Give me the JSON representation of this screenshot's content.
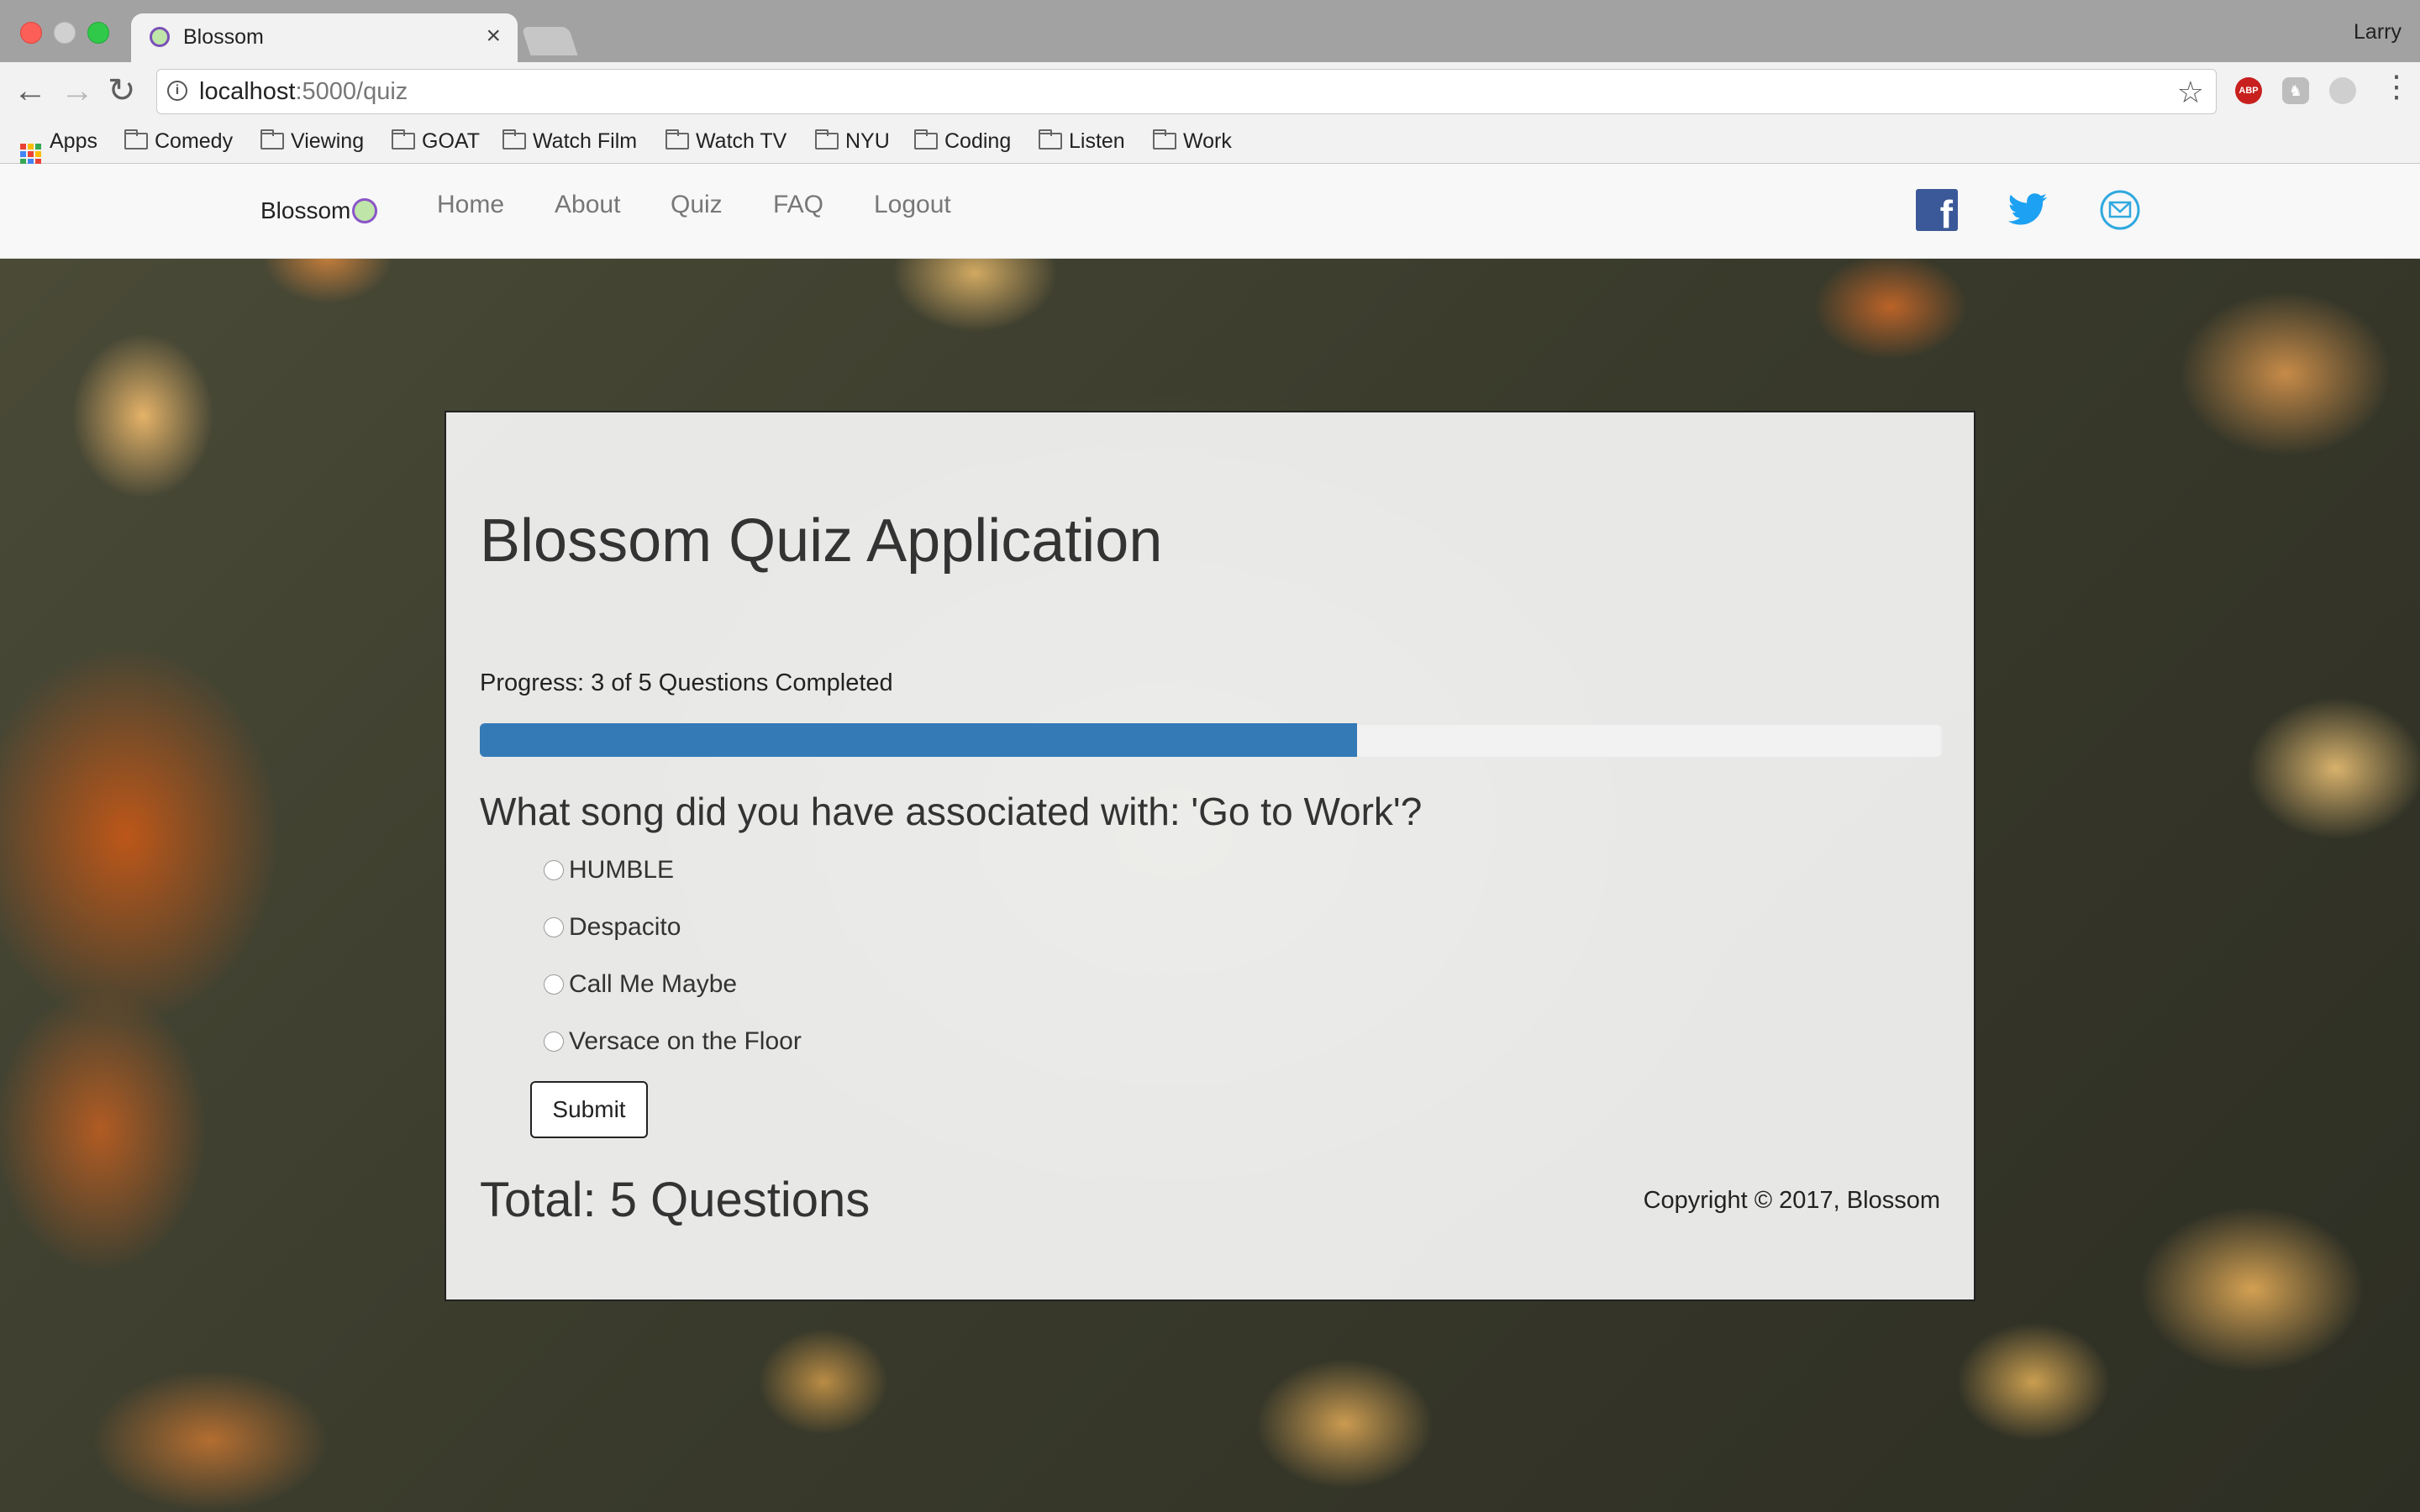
{
  "browser": {
    "tab_title": "Blossom",
    "tab_close": "×",
    "profile_name": "Larry",
    "url_host": "localhost",
    "url_path": ":5000/quiz",
    "bookmarks": [
      "Apps",
      "Comedy",
      "Viewing",
      "GOAT",
      "Watch Film",
      "Watch TV",
      "NYU",
      "Coding",
      "Listen",
      "Work"
    ],
    "icons": {
      "back": "arrow-left-icon",
      "forward": "arrow-right-icon",
      "reload": "reload-icon",
      "star": "star-icon",
      "menu": "kebab-menu-icon"
    },
    "extension_abp_label": "ABP"
  },
  "navbar": {
    "brand": "Blossom",
    "links": [
      "Home",
      "About",
      "Quiz",
      "FAQ",
      "Logout"
    ],
    "social": [
      "facebook-icon",
      "twitter-icon",
      "email-icon"
    ],
    "colors": {
      "facebook": "#3b5998",
      "twitter": "#1da1f2",
      "email": "#2fa8df"
    }
  },
  "quiz": {
    "title": "Blossom Quiz Application",
    "progress_text": "Progress: 3 of 5 Questions Completed",
    "progress": {
      "completed": 3,
      "total": 5,
      "fraction": 0.6,
      "color": "#337ab7"
    },
    "question": "What song did you have associated with: 'Go to Work'?",
    "options": [
      "HUMBLE",
      "Despacito",
      "Call Me Maybe",
      "Versace on the Floor"
    ],
    "submit_label": "Submit",
    "total_text": "Total: 5 Questions",
    "copyright": "Copyright © 2017, Blossom"
  }
}
